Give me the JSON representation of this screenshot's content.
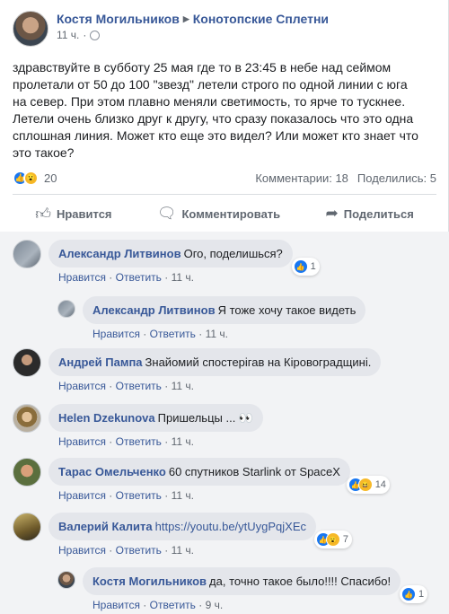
{
  "post": {
    "author": "Костя Могильников",
    "group": "Конотопские Сплетни",
    "time": "11 ч.",
    "text": "здравствуйте в субботу 25 мая где то в 23:45 в небе над сеймом\nпролетали от 50 до 100 \"звезд\" летели строго по одной линии с юга\nна север. При этом плавно меняли светимость, то ярче то тускнее.\nЛетели очень близко друг к другу, что сразу показалось что это одна\nсплошная линия. Может кто еще это видел? Или может кто знает что\nэто такое?",
    "reaction_count": "20",
    "comments_label": "Комментарии: 18",
    "shares_label": "Поделились: 5"
  },
  "actions": {
    "like": "Нравится",
    "comment": "Комментировать",
    "share": "Поделиться"
  },
  "comment_actions": {
    "like": "Нравится",
    "reply": "Ответить",
    "sep": "·"
  },
  "comments": [
    {
      "author": "Александр Литвинов",
      "text": "Ого, поделишься?",
      "time": "11 ч.",
      "reactions": "1"
    },
    {
      "author": "Александр Литвинов",
      "text": "Я тоже хочу такое видеть",
      "time": "11 ч."
    },
    {
      "author": "Андрей Пампа",
      "text": "Знайомий спостерігав на Кіровоградщині.",
      "time": "11 ч."
    },
    {
      "author": "Helen Dzekunova",
      "text": "Пришельцы ... 👀",
      "time": "11 ч."
    },
    {
      "author": "Тарас Омельченко",
      "text": "60 спутников Starlink от SpaceX",
      "time": "11 ч.",
      "reactions": "14"
    },
    {
      "author": "Валерий Калита",
      "text": "https://youtu.be/ytUygPqjXEc",
      "time": "11 ч.",
      "reactions": "7"
    },
    {
      "author": "Костя Могильников",
      "text": "да, точно такое было!!!! Спасибо!",
      "time": "9 ч.",
      "reactions": "1"
    }
  ],
  "colors": {
    "link": "#385898",
    "like_blue": "#1877f2",
    "bubble": "#e4e6eb",
    "wow_yellow": "#f7b928"
  },
  "icons": {
    "like": "thumbs-up-icon",
    "comment": "comment-icon",
    "share": "share-icon",
    "privacy": "globe-icon"
  }
}
